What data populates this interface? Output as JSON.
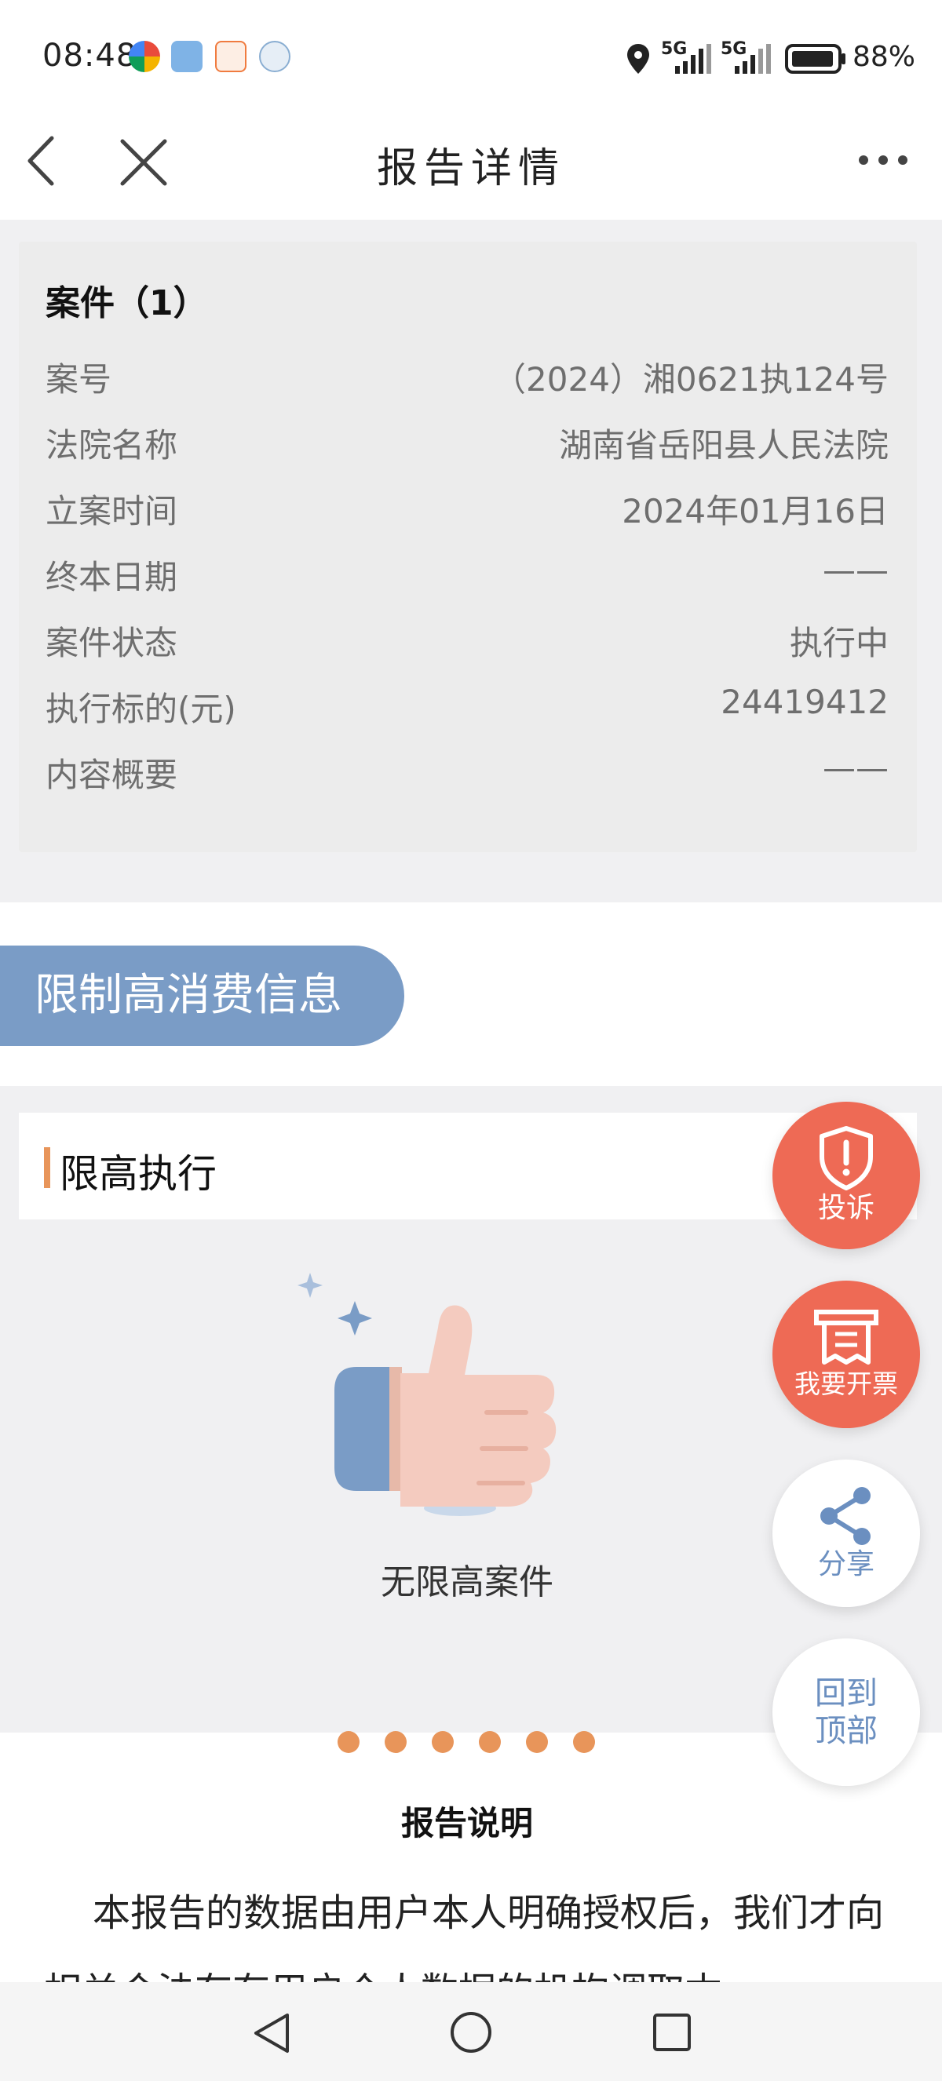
{
  "status_bar": {
    "time": "08:48",
    "battery": "88%",
    "signal_1": "5G",
    "signal_2": "5G"
  },
  "nav": {
    "title": "报告详情"
  },
  "case": {
    "title": "案件（1）",
    "rows": [
      {
        "label": "案号",
        "value": "（2024）湘0621执124号"
      },
      {
        "label": "法院名称",
        "value": "湖南省岳阳县人民法院"
      },
      {
        "label": "立案时间",
        "value": "2024年01月16日"
      },
      {
        "label": "终本日期",
        "value": "——"
      },
      {
        "label": "案件状态",
        "value": "执行中"
      },
      {
        "label": "执行标的(元)",
        "value": "24419412"
      },
      {
        "label": "内容概要",
        "value": "——"
      }
    ]
  },
  "restriction_section": {
    "label": "限制高消费信息",
    "header": "限高执行",
    "empty_text": "无限高案件"
  },
  "report": {
    "title": "报告说明",
    "body": "本报告的数据由用户本人明确授权后，我们才向相关合法存有用户个人数据的机构调取本"
  },
  "fabs": {
    "complaint": "投诉",
    "invoice": "我要开票",
    "share": "分享",
    "back_top_1": "回到",
    "back_top_2": "顶部"
  },
  "colors": {
    "accent_blue": "#7a9cc6",
    "accent_orange": "#e8955a",
    "fab_red": "#ee6a55"
  }
}
